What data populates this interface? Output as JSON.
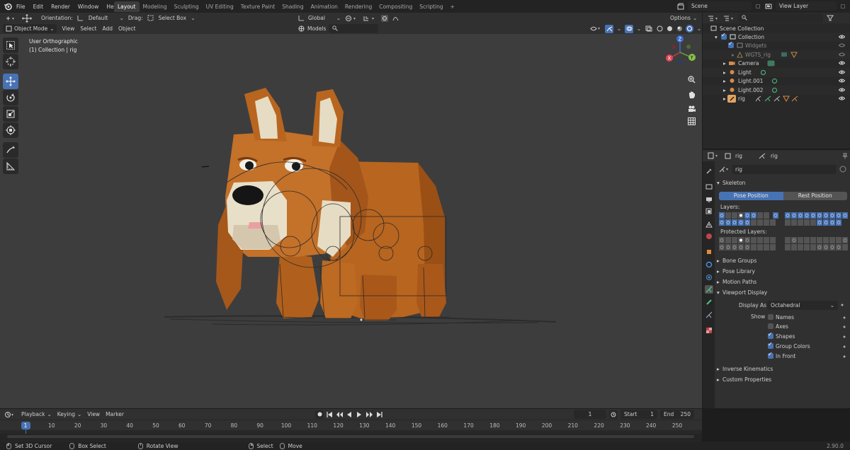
{
  "menu": [
    "File",
    "Edit",
    "Render",
    "Window",
    "Help"
  ],
  "workspaces": [
    "Layout",
    "Modeling",
    "Sculpting",
    "UV Editing",
    "Texture Paint",
    "Shading",
    "Animation",
    "Rendering",
    "Compositing",
    "Scripting"
  ],
  "workspace_active": "Layout",
  "topright": {
    "scene": "Scene",
    "view_layer": "View Layer"
  },
  "toolbar1": {
    "orientation_label": "Orientation:",
    "orientation_value": "Default",
    "drag_label": "Drag:",
    "drag_value": "Select Box",
    "transform_orientation": "Global",
    "options_label": "Options"
  },
  "toolbar2": {
    "mode": "Object Mode",
    "menus": [
      "View",
      "Select",
      "Add",
      "Object"
    ],
    "models_label": "Models"
  },
  "viewport": {
    "view_name": "User Orthographic",
    "collection_info": "(1) Collection | rig"
  },
  "gizmo": {
    "x": "X",
    "y": "Y",
    "z": "Z"
  },
  "outliner": {
    "root": "Scene Collection",
    "items": [
      {
        "name": "Collection",
        "level": 1
      },
      {
        "name": "Widgets",
        "level": 2,
        "dim": true
      },
      {
        "name": "WGTS_rig",
        "level": 3,
        "dim": true
      },
      {
        "name": "Camera",
        "level": 2
      },
      {
        "name": "Light",
        "level": 2
      },
      {
        "name": "Light.001",
        "level": 2
      },
      {
        "name": "Light.002",
        "level": 2
      },
      {
        "name": "rig",
        "level": 2
      }
    ]
  },
  "properties": {
    "breadcrumb_object": "rig",
    "breadcrumb_data": "rig",
    "datablock_name": "rig",
    "skeleton_title": "Skeleton",
    "pose_position": "Pose Position",
    "rest_position": "Rest Position",
    "layers_label": "Layers:",
    "protected_layers_label": "Protected Layers:",
    "panels_collapsed": [
      "Bone Groups",
      "Pose Library",
      "Motion Paths"
    ],
    "viewport_display_title": "Viewport Display",
    "display_as_label": "Display As",
    "display_as_value": "Octahedral",
    "show_label": "Show",
    "show_options": [
      {
        "label": "Names",
        "checked": false
      },
      {
        "label": "Axes",
        "checked": false
      },
      {
        "label": "Shapes",
        "checked": true
      },
      {
        "label": "Group Colors",
        "checked": true
      },
      {
        "label": "In Front",
        "checked": true
      }
    ],
    "panels_bottom": [
      "Inverse Kinematics",
      "Custom Properties"
    ]
  },
  "timeline": {
    "menus": [
      "Playback",
      "Keying",
      "View",
      "Marker"
    ],
    "current_frame": "1",
    "start_label": "Start",
    "start_value": "1",
    "end_label": "End",
    "end_value": "250",
    "frames": [
      "1",
      "10",
      "20",
      "30",
      "40",
      "50",
      "60",
      "70",
      "80",
      "90",
      "100",
      "110",
      "120",
      "130",
      "140",
      "150",
      "160",
      "170",
      "180",
      "190",
      "200",
      "210",
      "220",
      "230",
      "240",
      "250"
    ]
  },
  "status": {
    "items": [
      "Set 3D Cursor",
      "Box Select",
      "Rotate View",
      "Select",
      "Move"
    ],
    "version": "2.90.0"
  },
  "colors": {
    "accent": "#4772b3",
    "viewport_bg": "#3d3d3d",
    "dog_body": "#b8651f",
    "dog_light": "#e8dfc8"
  }
}
